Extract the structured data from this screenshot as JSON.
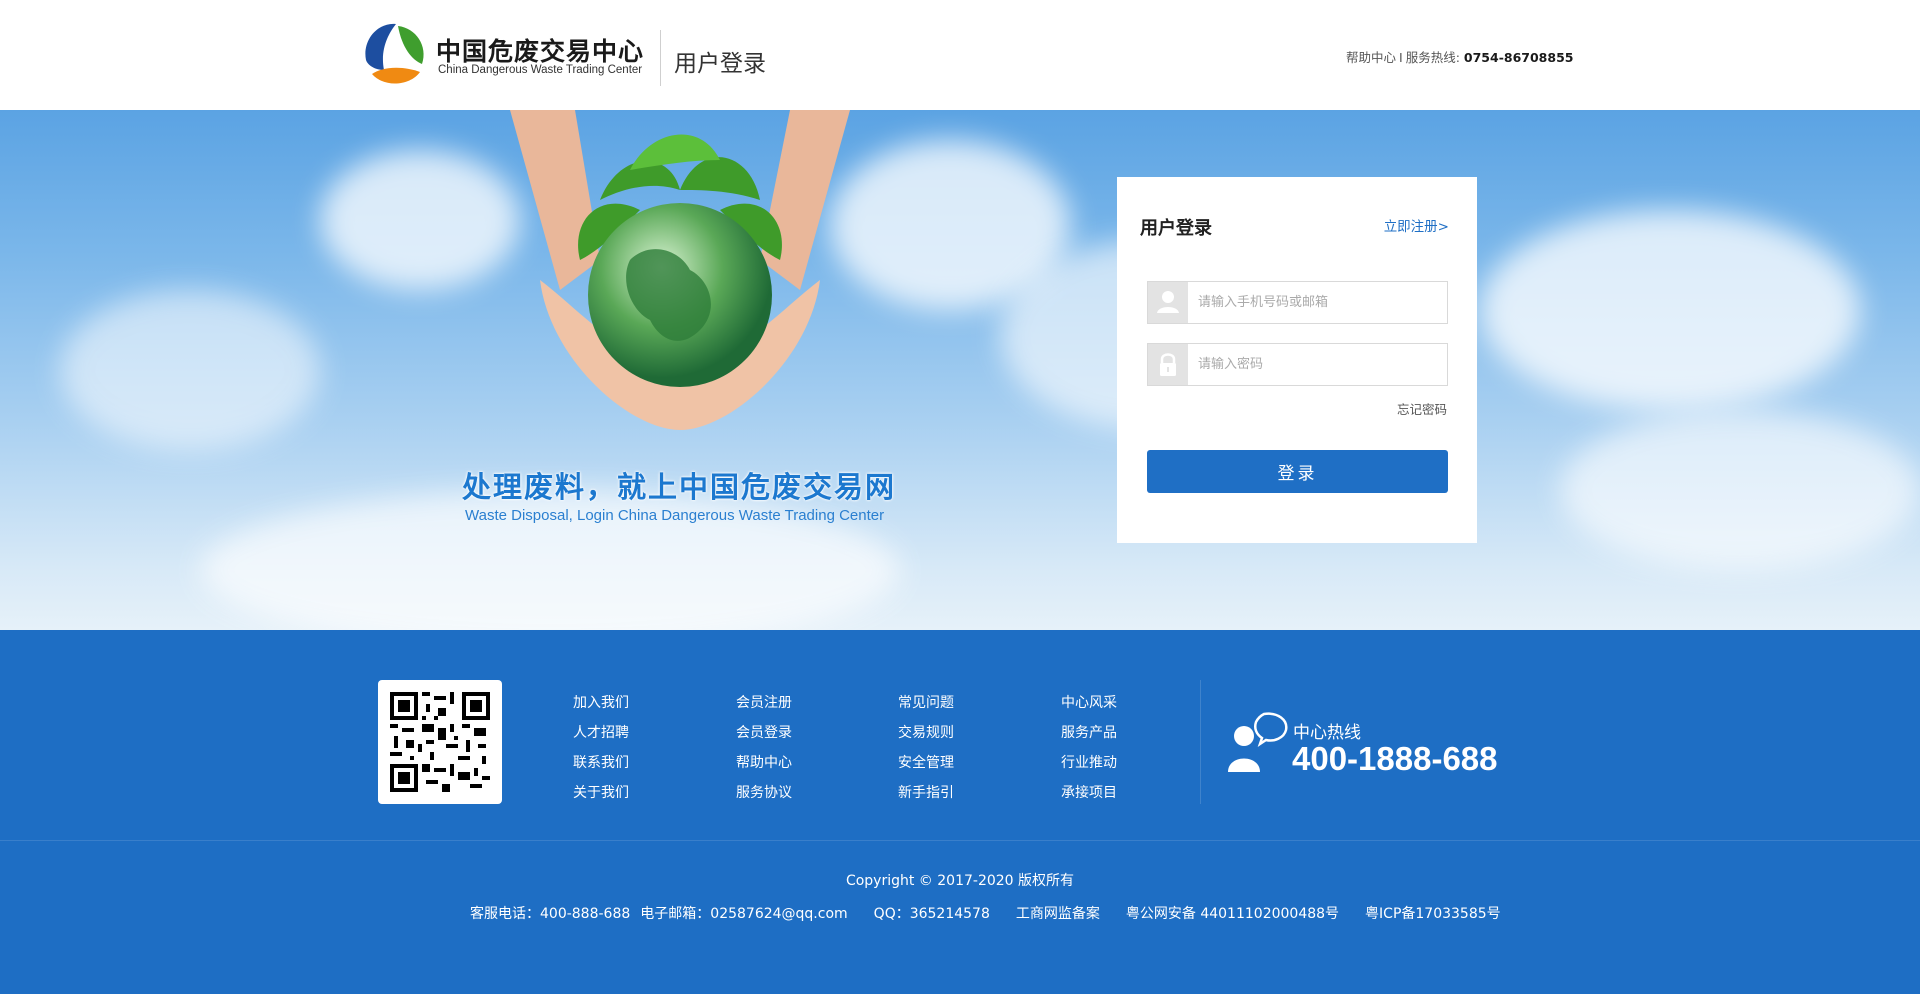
{
  "header": {
    "brand_cn": "中国危废交易中心",
    "brand_en": "China Dangerous Waste Trading Center",
    "page_title": "用户登录",
    "help_center": "帮助中心",
    "separator": "I",
    "hotline_label": "服务热线:",
    "hotline_number": "0754-86708855"
  },
  "banner": {
    "slogan_cn": "处理废料，就上中国危废交易网",
    "slogan_en": "Waste Disposal,   Login China Dangerous Waste Trading Center"
  },
  "login": {
    "title": "用户登录",
    "register_link": "立即注册>",
    "username_placeholder": "请输入手机号码或邮箱",
    "password_placeholder": "请输入密码",
    "forgot_password": "忘记密码",
    "submit_label": "登录"
  },
  "footer": {
    "link_columns": [
      [
        "加入我们",
        "人才招聘",
        "联系我们",
        "关于我们"
      ],
      [
        "会员注册",
        "会员登录",
        "帮助中心",
        "服务协议"
      ],
      [
        "常见问题",
        "交易规则",
        "安全管理",
        "新手指引"
      ],
      [
        "中心风采",
        "服务产品",
        "行业推动",
        "承接项目"
      ]
    ],
    "hotline_label": "中心热线",
    "hotline_number": "400-1888-688",
    "copyright": "Copyright © 2017-2020  版权所有",
    "contact": {
      "phone": "客服电话：400-888-688",
      "email": "电子邮箱：02587624@qq.com",
      "qq": "QQ：365214578",
      "icp_monitor": "工商网监备案",
      "police_record": "粤公网安备 44011102000488号",
      "icp": "粤ICP备17033585号"
    }
  },
  "colors": {
    "primary": "#1f6fc5",
    "footer_bg": "#1e6ec4",
    "sky_top": "#5ba3e3"
  },
  "icons": {
    "logo": "leaf-logo-icon",
    "username": "user-icon",
    "password": "lock-icon",
    "qr": "qr-code",
    "hotline": "customer-service-icon"
  }
}
